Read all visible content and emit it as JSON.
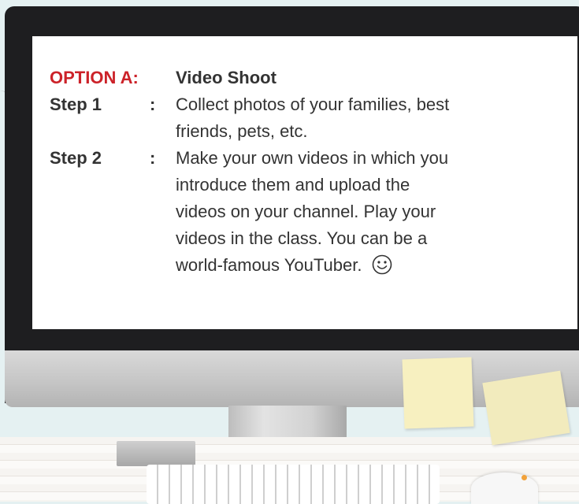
{
  "option": {
    "label": "OPTION A:",
    "title": "Video Shoot"
  },
  "steps": [
    {
      "label": "Step 1",
      "colon": ":",
      "lines": [
        "Collect photos of your families, best",
        "friends, pets, etc."
      ]
    },
    {
      "label": "Step 2",
      "colon": ":",
      "lines": [
        "Make your own videos in which you",
        "introduce them and upload the",
        "videos on your channel. Play your",
        "videos in the class. You can be a",
        "world-famous YouTuber."
      ]
    }
  ],
  "icons": {
    "smiley": "smiley-face-icon"
  },
  "colors": {
    "option_label": "#cc2229",
    "text": "#333333",
    "background": "#e5f1f2"
  }
}
